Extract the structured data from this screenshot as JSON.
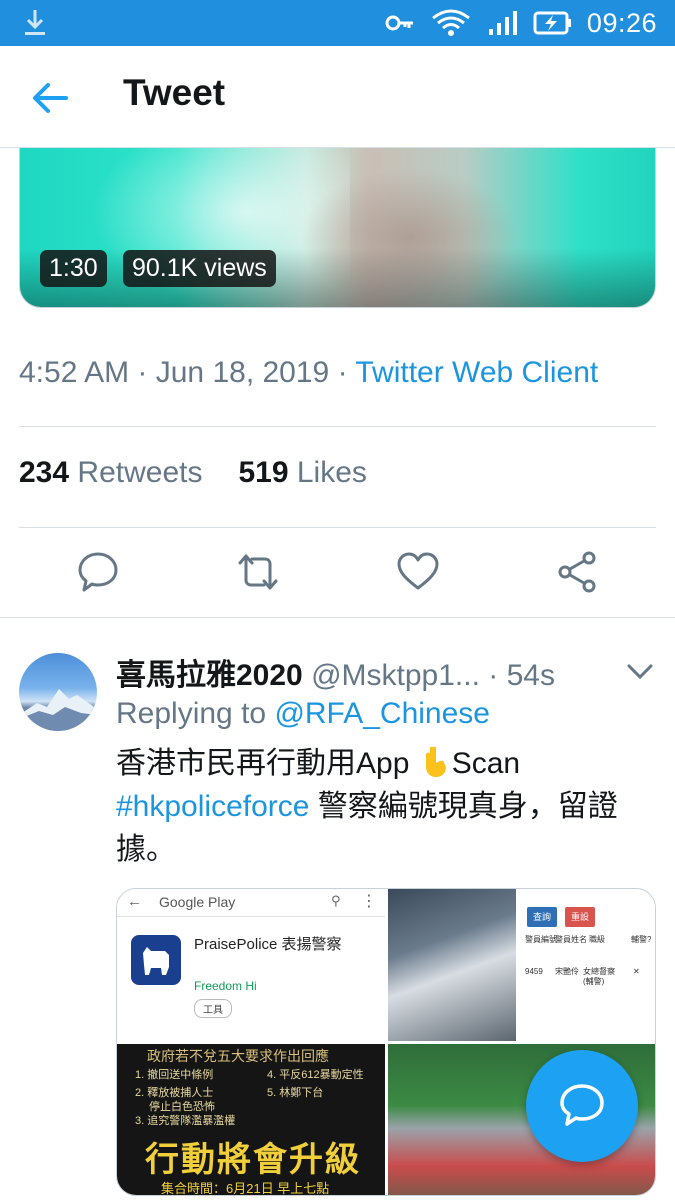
{
  "status_bar": {
    "time": "09:26",
    "icons": [
      "download-icon",
      "key-icon",
      "wifi-icon",
      "signal-icon",
      "battery-charging-icon"
    ]
  },
  "header": {
    "title": "Tweet",
    "back_icon": "back-arrow-icon"
  },
  "video": {
    "duration": "1:30",
    "views": "90.1K views"
  },
  "tweet_meta": {
    "time": "4:52 AM",
    "date": "Jun 18, 2019",
    "separator": " · ",
    "client": "Twitter Web Client"
  },
  "stats": {
    "retweets_count": "234",
    "retweets_label": "Retweets",
    "likes_count": "519",
    "likes_label": "Likes"
  },
  "actions": [
    "reply-icon",
    "retweet-icon",
    "like-icon",
    "share-icon"
  ],
  "reply": {
    "name": "喜馬拉雅2020",
    "handle": "@Msktpp1...",
    "time": "54s",
    "separator": " · ",
    "replying_prefix": "Replying to ",
    "replying_to": "@RFA_Chinese",
    "text_1": "香港市民再行動用App ",
    "text_2": "Scan",
    "hashtag": "#hkpoliceforce",
    "text_3": " 警察編號現真身，留證據。"
  },
  "media": {
    "store_name": "Google Play",
    "app_name": "PraisePolice 表揚警察",
    "app_developer": "Freedom Hi",
    "app_category": "工具",
    "query_button": "查詢",
    "reset_button": "重設",
    "col_headers": [
      "警員編號",
      "警員姓名",
      "職級",
      "輔警?"
    ],
    "row_values": [
      "9459",
      "宋艷伶",
      "女總督察(輔警)",
      "✕"
    ],
    "poster_lines": [
      "1. 撤回送中條例",
      "2. 釋放被捕人士",
      "停止白色恐怖",
      "3. 追究警隊濫暴濫權",
      "4. 平反612暴動定性",
      "5. 林鄭下台"
    ],
    "poster_head": "政府若不兌五大要求作出回應",
    "poster_big": "行動將會升級",
    "poster_foot": "集合時間：6月21日 早上七點"
  },
  "colors": {
    "status_bar": "#1f8fde",
    "accent": "#1da1f2",
    "link": "#1b95e0",
    "secondary_text": "#657786"
  }
}
